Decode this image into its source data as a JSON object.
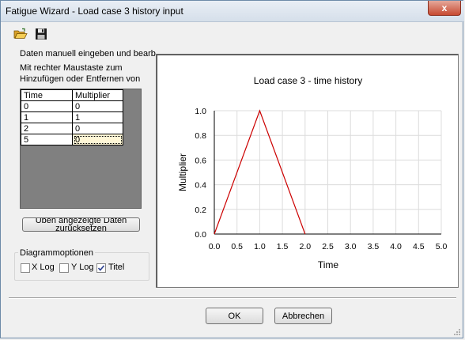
{
  "window": {
    "title": "Fatigue Wizard - Load case 3 history input",
    "close_label": "x"
  },
  "toolbar": {
    "open_icon": "folder-open-icon",
    "save_icon": "floppy-save-icon"
  },
  "left_panel": {
    "instruction_1": "Daten manuell eingeben und bearb",
    "instruction_2": "Mit rechter Maustaste zum",
    "instruction_3": "Hinzufügen oder Entfernen von",
    "grid": {
      "headers": [
        "Time",
        "Multiplier"
      ],
      "rows": [
        [
          "0",
          "0"
        ],
        [
          "1",
          "1"
        ],
        [
          "2",
          "0"
        ],
        [
          "5",
          "0"
        ]
      ]
    },
    "reset_button_line1": "Üben angezeigte Daten",
    "reset_button_line2": "zurücksetzen",
    "diagram_options": {
      "title": "Diagrammoptionen",
      "xlog_label": "X Log",
      "xlog_checked": false,
      "ylog_label": "Y Log",
      "ylog_checked": false,
      "titel_label": "Titel",
      "titel_checked": true
    }
  },
  "chart_data": {
    "type": "line",
    "title": "Load case 3 - time history",
    "xlabel": "Time",
    "ylabel": "Multiplier",
    "xlim": [
      0,
      5
    ],
    "ylim": [
      0,
      1
    ],
    "xticks": [
      "0.0",
      "0.5",
      "1.0",
      "1.5",
      "2.0",
      "2.5",
      "3.0",
      "3.5",
      "4.0",
      "4.5",
      "5.0"
    ],
    "yticks": [
      "0.0",
      "0.2",
      "0.4",
      "0.6",
      "0.8",
      "1.0"
    ],
    "grid": true,
    "series": [
      {
        "x": [
          0,
          1,
          2
        ],
        "y": [
          0,
          1,
          0
        ],
        "color": "#cc0000"
      }
    ]
  },
  "buttons": {
    "ok": "OK",
    "cancel": "Abbrechen"
  }
}
